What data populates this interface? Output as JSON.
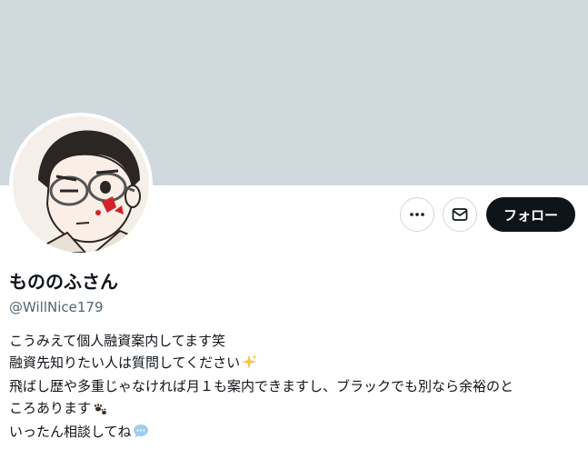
{
  "profile": {
    "display_name": "もののふさん",
    "handle": "@WillNice179",
    "bio_lines": [
      "こうみえて個人融資案内してます笑",
      "融資先知りたい人は質問してください",
      "飛ばし歴や多重じゃなければ月１も案内できますし、ブラックでも別なら余裕のと",
      "ころあります",
      "いったん相談してね"
    ]
  },
  "actions": {
    "more_icon": "more-horizontal-icon",
    "message_icon": "envelope-icon",
    "follow_label": "フォロー"
  },
  "colors": {
    "banner": "#cfd9de",
    "follow_button_bg": "#0f1419",
    "handle_text": "#536471"
  }
}
